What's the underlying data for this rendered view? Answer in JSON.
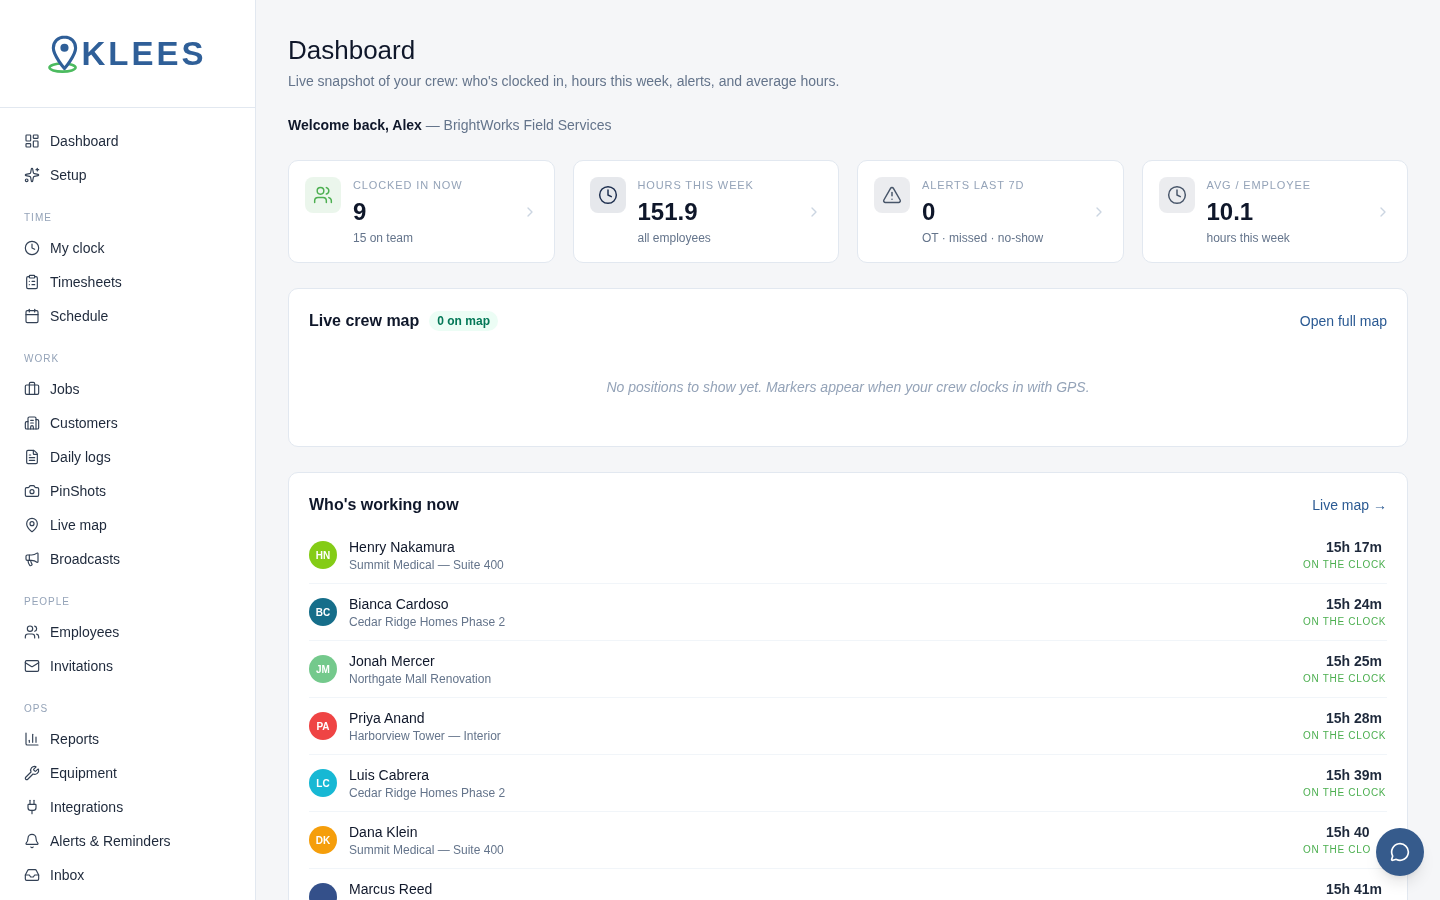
{
  "sidebar": {
    "logo": "KLEES",
    "sections": [
      {
        "items": [
          "Dashboard",
          "Setup"
        ]
      },
      {
        "title": "TIME",
        "items": [
          "My clock",
          "Timesheets",
          "Schedule"
        ]
      },
      {
        "title": "WORK",
        "items": [
          "Jobs",
          "Customers",
          "Daily logs",
          "PinShots",
          "Live map",
          "Broadcasts"
        ]
      },
      {
        "title": "PEOPLE",
        "items": [
          "Employees",
          "Invitations"
        ]
      },
      {
        "title": "OPS",
        "items": [
          "Reports",
          "Equipment",
          "Integrations",
          "Alerts & Reminders",
          "Inbox"
        ]
      }
    ]
  },
  "header": {
    "title": "Dashboard",
    "subtitle": "Live snapshot of your crew: who's clocked in, hours this week, alerts, and average hours.",
    "welcome": "**Welcome back, Alex** — BrightWorks Field Services"
  },
  "stats": [
    {
      "label": "CLOCKED IN NOW",
      "value": "9",
      "note": "15 on team",
      "color": "#4caf50"
    },
    {
      "label": "HOURS THIS WEEK",
      "value": "151.9",
      "note": "all employees",
      "color": "#1e2f4f"
    },
    {
      "label": "ALERTS LAST 7D",
      "value": "0",
      "note": "OT · missed · no-show",
      "color": "#475569"
    },
    {
      "label": "AVG / EMPLOYEE",
      "value": "10.1",
      "note": "hours this week",
      "color": "#475569"
    }
  ],
  "map_card": {
    "title": "Live crew map",
    "badge": "0 on map",
    "link": "Open full map",
    "empty_text": "No positions to show yet. Markers appear when your crew clocks in with GPS."
  },
  "working_now": {
    "title": "Who's working now",
    "link": "Live map →",
    "rows": [
      {
        "initials": "HN",
        "color": "#84cc16",
        "name": "Henry Nakamura",
        "site": "Summit Medical — Suite 400",
        "time": "15h 17m",
        "status": "ON THE CLOCK"
      },
      {
        "initials": "BC",
        "color": "#166e8a",
        "name": "Bianca Cardoso",
        "site": "Cedar Ridge Homes Phase 2",
        "time": "15h 24m",
        "status": "ON THE CLOCK"
      },
      {
        "initials": "JM",
        "color": "#74c98c",
        "name": "Jonah Mercer",
        "site": "Northgate Mall Renovation",
        "time": "15h 25m",
        "status": "ON THE CLOCK"
      },
      {
        "initials": "PA",
        "color": "#ef4444",
        "name": "Priya Anand",
        "site": "Harborview Tower — Interior",
        "time": "15h 28m",
        "status": "ON THE CLOCK"
      },
      {
        "initials": "LC",
        "color": "#17b8d4",
        "name": "Luis Cabrera",
        "site": "Cedar Ridge Homes Phase 2",
        "time": "15h 39m",
        "status": "ON THE CLOCK"
      },
      {
        "initials": "DK",
        "color": "#f59e0b",
        "name": "Dana Klein",
        "site": "Summit Medical — Suite 400",
        "time": "15h 40",
        "status": "ON THE CLO"
      },
      {
        "color": "#34508a",
        "name": "Marcus Reed",
        "time": "15h 41m"
      }
    ]
  }
}
